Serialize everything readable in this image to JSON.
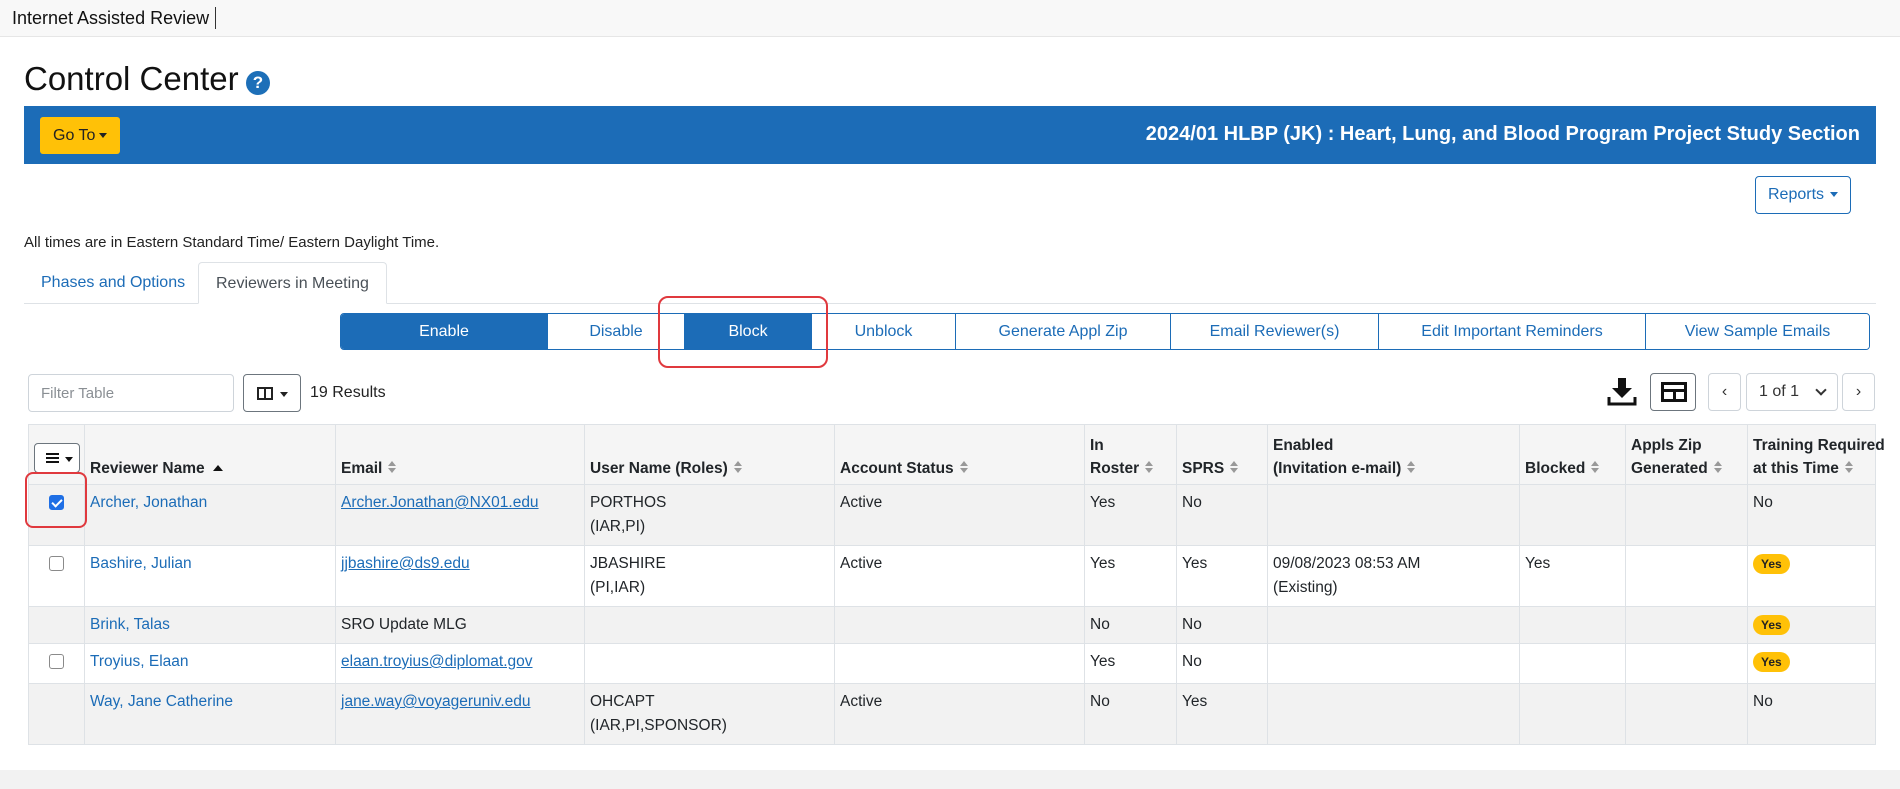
{
  "app": {
    "title": "Internet Assisted Review"
  },
  "page": {
    "title": "Control Center"
  },
  "header": {
    "goto_label": "Go To",
    "meeting_title": "2024/01 HLBP (JK) : Heart, Lung, and Blood Program Project Study Section"
  },
  "reports_label": "Reports",
  "timezone_note": "All times are in Eastern Standard Time/ Eastern Daylight Time.",
  "tabs": [
    {
      "label": "Phases and Options",
      "active": false
    },
    {
      "label": "Reviewers in Meeting",
      "active": true
    }
  ],
  "actions": [
    {
      "label": "Enable",
      "primary": true
    },
    {
      "label": "Disable",
      "primary": false
    },
    {
      "label": "Block",
      "primary": true
    },
    {
      "label": "Unblock",
      "primary": false
    },
    {
      "label": "Generate Appl Zip",
      "primary": false
    },
    {
      "label": "Email Reviewer(s)",
      "primary": false
    },
    {
      "label": "Edit Important Reminders",
      "primary": false
    },
    {
      "label": "View Sample Emails",
      "primary": false
    }
  ],
  "toolbar": {
    "filter_placeholder": "Filter Table",
    "results": "19 Results",
    "page_select": "1 of 1",
    "prev": "‹",
    "next": "›"
  },
  "table": {
    "headers": [
      {
        "l1": "",
        "l2": "Reviewer Name"
      },
      {
        "l1": "",
        "l2": "Email"
      },
      {
        "l1": "",
        "l2": "User Name (Roles)"
      },
      {
        "l1": "",
        "l2": "Account Status"
      },
      {
        "l1": "In",
        "l2": "Roster"
      },
      {
        "l1": "",
        "l2": "SPRS"
      },
      {
        "l1": "Enabled",
        "l2": "(Invitation e-mail)"
      },
      {
        "l1": "",
        "l2": "Blocked"
      },
      {
        "l1": "Appls Zip",
        "l2": "Generated"
      },
      {
        "l1": "Training Required",
        "l2": "at this Time"
      }
    ],
    "rows": [
      {
        "checkbox": "checked",
        "name": "Archer, Jonathan",
        "email": "Archer.Jonathan@NX01.edu",
        "email_link": true,
        "user": "PORTHOS",
        "roles": "(IAR,PI)",
        "status": "Active",
        "roster": "Yes",
        "sprs": "No",
        "enabled": "",
        "enabled2": "",
        "blocked": "",
        "zip": "",
        "training": "No",
        "training_badge": false
      },
      {
        "checkbox": "unchecked",
        "name": "Bashire, Julian",
        "email": "jjbashire@ds9.edu",
        "email_link": true,
        "user": "JBASHIRE",
        "roles": "(PI,IAR)",
        "status": "Active",
        "roster": "Yes",
        "sprs": "Yes",
        "enabled": "09/08/2023 08:53 AM",
        "enabled2": "(Existing)",
        "blocked": "Yes",
        "zip": "",
        "training": "Yes",
        "training_badge": true
      },
      {
        "checkbox": "none",
        "name": "Brink, Talas",
        "email": "SRO Update MLG",
        "email_link": false,
        "user": "",
        "roles": "",
        "status": "",
        "roster": "No",
        "sprs": "No",
        "enabled": "",
        "enabled2": "",
        "blocked": "",
        "zip": "",
        "training": "Yes",
        "training_badge": true
      },
      {
        "checkbox": "unchecked",
        "name": "Troyius, Elaan",
        "email": "elaan.troyius@diplomat.gov",
        "email_link": true,
        "user": "",
        "roles": "",
        "status": "",
        "roster": "Yes",
        "sprs": "No",
        "enabled": "",
        "enabled2": "",
        "blocked": "",
        "zip": "",
        "training": "Yes",
        "training_badge": true
      },
      {
        "checkbox": "none",
        "name": "Way, Jane Catherine",
        "email": "jane.way@voyageruniv.edu",
        "email_link": true,
        "user": "OHCAPT",
        "roles": "(IAR,PI,SPONSOR)",
        "status": "Active",
        "roster": "No",
        "sprs": "Yes",
        "enabled": "",
        "enabled2": "",
        "blocked": "",
        "zip": "",
        "training": "No",
        "training_badge": false
      }
    ]
  },
  "colors": {
    "brand_blue": "#1c6cb7",
    "goto_yellow": "#ffc107",
    "annotation_red": "#e0393e"
  },
  "icons": [
    "help-icon",
    "download-icon",
    "table-view-icon",
    "column-picker-icon",
    "menu-icon",
    "sort-icon"
  ]
}
